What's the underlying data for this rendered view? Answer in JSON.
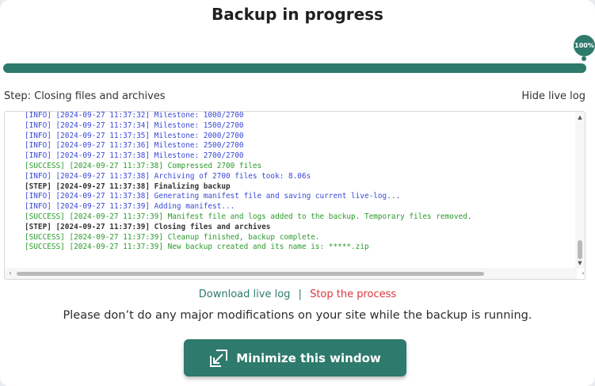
{
  "title": "Backup in progress",
  "progress": {
    "percent": 100,
    "badge_label": "100%"
  },
  "step_text": "Step: Closing files and archives",
  "hide_log_label": "Hide live log",
  "log_lines": [
    {
      "type": "info",
      "text": "[INFO] [2024-09-27 11:37:32] Milestone: 1000/2700"
    },
    {
      "type": "info",
      "text": "[INFO] [2024-09-27 11:37:34] Milestone: 1500/2700"
    },
    {
      "type": "info",
      "text": "[INFO] [2024-09-27 11:37:35] Milestone: 2000/2700"
    },
    {
      "type": "info",
      "text": "[INFO] [2024-09-27 11:37:36] Milestone: 2500/2700"
    },
    {
      "type": "info",
      "text": "[INFO] [2024-09-27 11:37:38] Milestone: 2700/2700"
    },
    {
      "type": "success",
      "text": "[SUCCESS] [2024-09-27 11:37:38] Compressed 2700 files"
    },
    {
      "type": "info",
      "text": "[INFO] [2024-09-27 11:37:38] Archiving of 2700 files took: 8.06s"
    },
    {
      "type": "step",
      "text": "[STEP] [2024-09-27 11:37:38] Finalizing backup"
    },
    {
      "type": "info",
      "text": "[INFO] [2024-09-27 11:37:38] Generating manifest file and saving current live-log..."
    },
    {
      "type": "info",
      "text": "[INFO] [2024-09-27 11:37:39] Adding manifest..."
    },
    {
      "type": "success",
      "text": "[SUCCESS] [2024-09-27 11:37:39] Manifest file and logs added to the backup. Temporary files removed."
    },
    {
      "type": "step",
      "text": "[STEP] [2024-09-27 11:37:39] Closing files and archives"
    },
    {
      "type": "success",
      "text": "[SUCCESS] [2024-09-27 11:37:39] Cleanup finished, backup complete."
    },
    {
      "type": "success",
      "text": "[SUCCESS] [2024-09-27 11:37:39] New backup created and its name is: *****.zip"
    }
  ],
  "links": {
    "download": "Download live log",
    "separator": "|",
    "stop": "Stop the process"
  },
  "warning": "Please don’t do any major modifications on your site while the backup is running.",
  "minimize_button": {
    "label": "Minimize this window",
    "icon": "minimize-arrow-icon"
  },
  "colors": {
    "accent": "#2e7a6c",
    "danger": "#d9363e",
    "info": "#3a49d8",
    "success": "#2c9a2c"
  }
}
